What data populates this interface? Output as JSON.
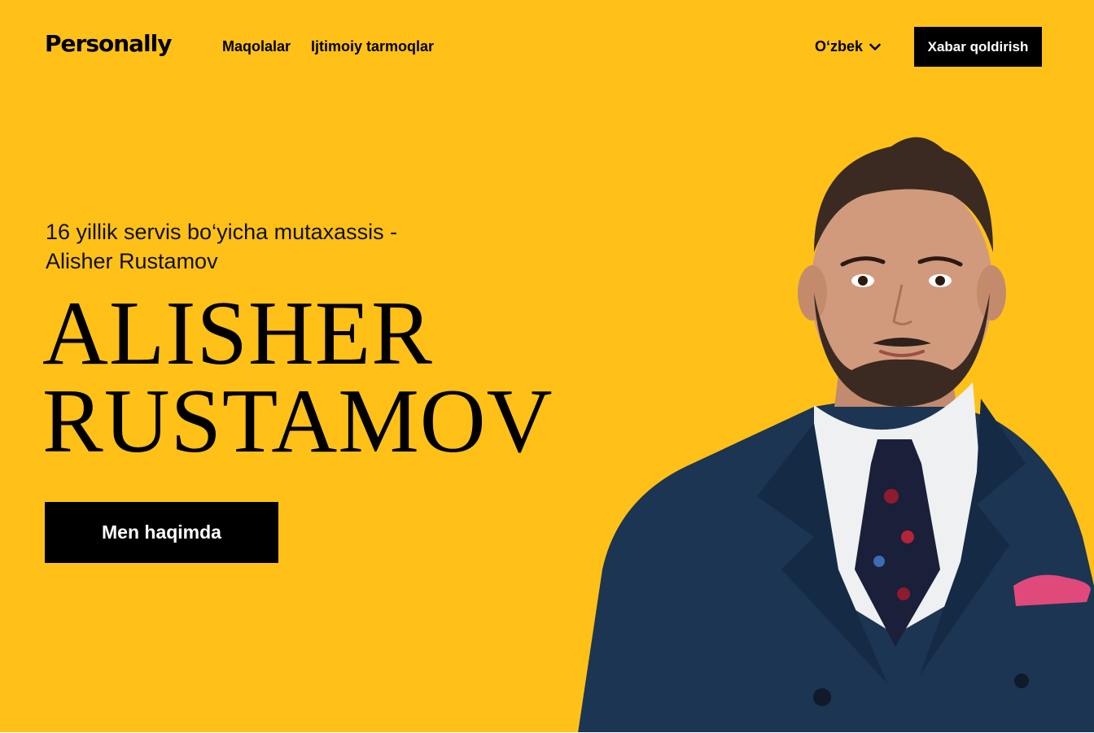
{
  "brand": {
    "logo": "Personally"
  },
  "nav": {
    "items": [
      {
        "label": "Maqolalar"
      },
      {
        "label": "Ijtimoiy tarmoqlar"
      }
    ]
  },
  "language": {
    "selected": "O‘zbek",
    "icon": "chevron-down-icon"
  },
  "header_cta": {
    "label": "Xabar qoldirish"
  },
  "hero": {
    "subtitle_line1": "16 yillik servis bo‘yicha mutaxassis -",
    "subtitle_line2": "Alisher Rustamov",
    "name_line1": "ALISHER",
    "name_line2": "RUSTAMOV",
    "about_button": "Men haqimda"
  },
  "colors": {
    "background": "#ffc118",
    "button": "#000000",
    "button_text": "#ffffff",
    "suit": "#1c3553"
  }
}
